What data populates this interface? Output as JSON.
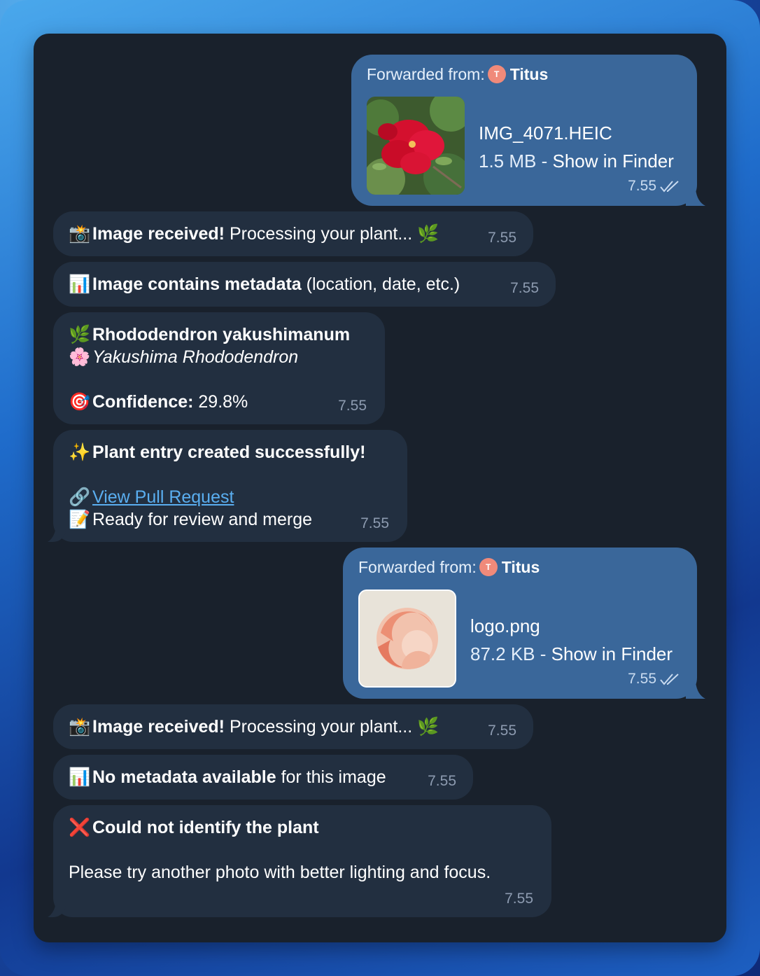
{
  "messages": {
    "fwd1": {
      "forwarded_label": "Forwarded from:",
      "sender_initial": "T",
      "sender": "Titus",
      "file_name": "IMG_4071.HEIC",
      "file_size": "1.5 MB",
      "separator": " - ",
      "show_in_finder": "Show in Finder",
      "time": "7.55"
    },
    "m1": {
      "emoji": "📸",
      "bold": "Image received!",
      "text": " Processing your plant... ",
      "emoji_end": "🌿",
      "time": "7.55"
    },
    "m2": {
      "emoji": "📊",
      "bold": "Image contains metadata",
      "text": " (location, date, etc.)",
      "time": "7.55"
    },
    "m3": {
      "emoji1": "🌿",
      "name": "Rhododendron yakushimanum",
      "emoji2": "🌸",
      "common": "Yakushima Rhododendron",
      "emoji3": "🎯",
      "confidence_label": "Confidence:",
      "confidence_value": " 29.8%",
      "time": "7.55"
    },
    "m4": {
      "emoji1": "✨",
      "title": "Plant entry created successfully!",
      "emoji2": "🔗",
      "link": "View Pull Request",
      "emoji3": "📝",
      "text": "Ready for review and merge",
      "time": "7.55"
    },
    "fwd2": {
      "forwarded_label": "Forwarded from:",
      "sender_initial": "T",
      "sender": "Titus",
      "file_name": "logo.png",
      "file_size": "87.2 KB",
      "separator": " - ",
      "show_in_finder": "Show in Finder",
      "time": "7.55"
    },
    "m5": {
      "emoji": "📸",
      "bold": "Image received!",
      "text": " Processing your plant... ",
      "emoji_end": "🌿",
      "time": "7.55"
    },
    "m6": {
      "emoji": "📊",
      "bold": "No metadata available",
      "text": " for this image",
      "time": "7.55"
    },
    "m7": {
      "emoji": "❌",
      "title": "Could not identify the plant",
      "text": "Please try another photo with better lighting and focus.",
      "time": "7.55"
    }
  },
  "colors": {
    "incoming_bubble": "#222f40",
    "outgoing_bubble": "#3a679a",
    "background": "#19212c",
    "link": "#5aaef0"
  }
}
